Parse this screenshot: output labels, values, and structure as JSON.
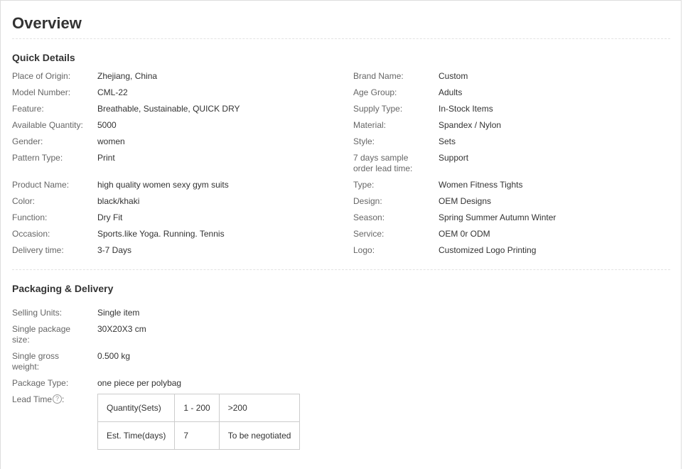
{
  "page_title": "Overview",
  "quick_details": {
    "heading": "Quick Details",
    "left": [
      {
        "label": "Place of Origin:",
        "value": "Zhejiang, China"
      },
      {
        "label": "Model Number:",
        "value": "CML-22"
      },
      {
        "label": "Feature:",
        "value": "Breathable, Sustainable, QUICK DRY"
      },
      {
        "label": "Available Quantity:",
        "value": "5000"
      },
      {
        "label": "Gender:",
        "value": "women"
      },
      {
        "label": "Pattern Type:",
        "value": "Print"
      },
      {
        "label": "Product Name:",
        "value": "high quality women sexy gym suits"
      },
      {
        "label": "Color:",
        "value": "black/khaki"
      },
      {
        "label": "Function:",
        "value": "Dry Fit"
      },
      {
        "label": "Occasion:",
        "value": "Sports.like Yoga. Running. Tennis"
      },
      {
        "label": "Delivery time:",
        "value": "3-7 Days"
      }
    ],
    "right": [
      {
        "label": "Brand Name:",
        "value": "Custom"
      },
      {
        "label": "Age Group:",
        "value": "Adults"
      },
      {
        "label": "Supply Type:",
        "value": "In-Stock Items"
      },
      {
        "label": "Material:",
        "value": "Spandex / Nylon"
      },
      {
        "label": "Style:",
        "value": "Sets"
      },
      {
        "label": "7 days sample order lead time:",
        "value": "Support"
      },
      {
        "label": "Type:",
        "value": "Women Fitness Tights"
      },
      {
        "label": "Design:",
        "value": "OEM Designs"
      },
      {
        "label": "Season:",
        "value": "Spring Summer Autumn Winter"
      },
      {
        "label": "Service:",
        "value": "OEM 0r ODM"
      },
      {
        "label": "Logo:",
        "value": "Customized Logo Printing"
      }
    ]
  },
  "packaging": {
    "heading": "Packaging & Delivery",
    "items": [
      {
        "label": "Selling Units:",
        "value": "Single item"
      },
      {
        "label": "Single package size:",
        "value": "30X20X3 cm"
      },
      {
        "label": "Single gross weight:",
        "value": "0.500 kg"
      },
      {
        "label": "Package Type:",
        "value": "one piece per polybag"
      }
    ],
    "lead_time_label": "Lead Time",
    "lead_time_colon": ":",
    "help_glyph": "?",
    "lead_time_table": {
      "rows": [
        [
          "Quantity(Sets)",
          "1 - 200",
          ">200"
        ],
        [
          "Est. Time(days)",
          "7",
          "To be negotiated"
        ]
      ]
    }
  }
}
